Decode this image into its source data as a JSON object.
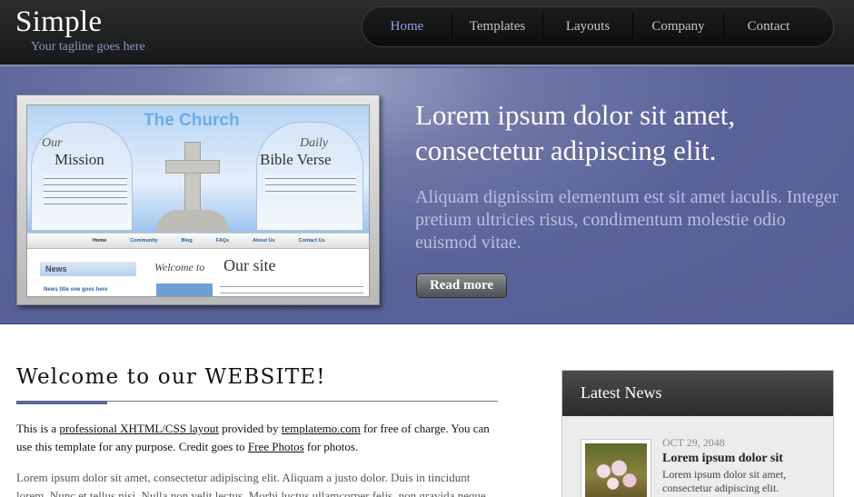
{
  "header": {
    "site_title": "Simple",
    "tagline": "Your tagline goes here",
    "nav": [
      {
        "label": "Home",
        "active": true
      },
      {
        "label": "Templates",
        "active": false
      },
      {
        "label": "Layouts",
        "active": false
      },
      {
        "label": "Company",
        "active": false
      },
      {
        "label": "Contact",
        "active": false
      }
    ]
  },
  "hero": {
    "heading": "Lorem ipsum dolor sit amet, consectetur adipiscing elit.",
    "text": "Aliquam dignissim elementum est sit amet iaculis. Integer pretium ultricies risus, condimentum molestie odio euismod vitae.",
    "button": "Read more",
    "preview": {
      "church": "The Church",
      "our": "Our",
      "mission": "Mission",
      "daily": "Daily",
      "bible": "Bible Verse",
      "nav": [
        "Home",
        "Community",
        "Blog",
        "FAQs",
        "About Us",
        "Contact Us"
      ],
      "news": "News",
      "news_link": "News title one goes here",
      "welcome": "Welcome to",
      "our_site": "Our site"
    }
  },
  "main": {
    "title": "Welcome to our WEBSITE!",
    "intro": {
      "t1": "This is a ",
      "link1": "professional XHTML/CSS layout",
      "t2": " provided by ",
      "link2": "templatemo.com",
      "t3": " for free of charge. You can use this template for any purpose. Credit goes to ",
      "link3": "Free Photos",
      "t4": " for photos."
    },
    "lorem": "Lorem ipsum dolor sit amet, consectetur adipiscing elit. Aliquam a justo dolor. Duis in tincidunt lorem. Nunc et tellus nisi. Nulla non velit lectus. Morbi luctus ullamcorper felis, non gravida neque."
  },
  "sidebar": {
    "title": "Latest News",
    "item": {
      "date": "OCT 29, 2048",
      "title": "Lorem ipsum dolor sit",
      "text": "Lorem ipsum dolor sit amet, consectetur adipiscing elit."
    }
  }
}
